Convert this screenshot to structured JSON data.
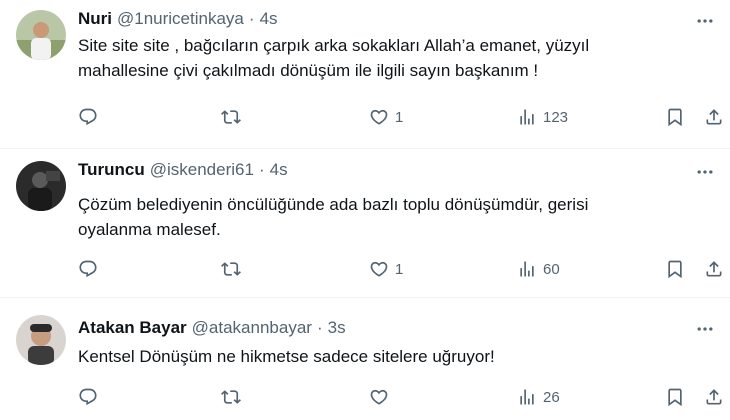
{
  "tweets": [
    {
      "name": "Nuri",
      "handle": "@1nuricetinkaya",
      "separator": "·",
      "time": "4s",
      "text_lines": [
        "Site site site , bağcıların çarpık arka sokakları Allah’a emanet, yüzyıl",
        "mahallesine çivi çakılmadı dönüşüm ile ilgili sayın başkanım !"
      ],
      "replies": "",
      "retweets": "",
      "likes": "1",
      "views": "123"
    },
    {
      "name": "Turuncu",
      "handle": "@iskenderi61",
      "separator": "·",
      "time": "4s",
      "text_lines": [
        "Çözüm belediyenin öncülüğünde ada bazlı toplu dönüşümdür, gerisi",
        "oyalanma malesef."
      ],
      "replies": "",
      "retweets": "",
      "likes": "1",
      "views": "60"
    },
    {
      "name": "Atakan Bayar",
      "handle": "@atakannbayar",
      "separator": "·",
      "time": "3s",
      "text_lines": [
        "Kentsel Dönüşüm ne hikmetse sadece sitelere uğruyor!"
      ],
      "replies": "",
      "retweets": "",
      "likes": "",
      "views": "26"
    }
  ],
  "icons": {
    "more": "more-dots-icon",
    "reply": "reply-bubble-icon",
    "retweet": "retweet-icon",
    "like": "heart-icon",
    "views": "views-bar-chart-icon",
    "bookmark": "bookmark-icon",
    "share": "share-upload-icon"
  },
  "colors": {
    "text": "#0f1419",
    "secondary": "#536471",
    "divider": "#eff3f4"
  }
}
